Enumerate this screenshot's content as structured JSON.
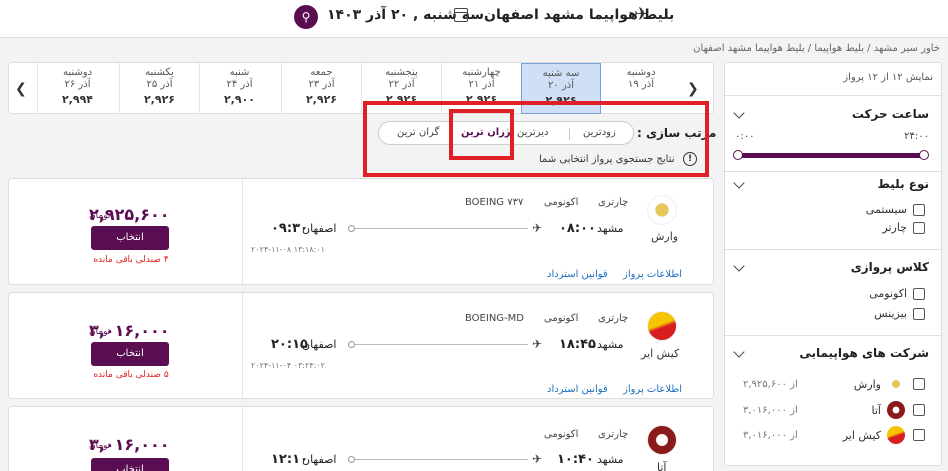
{
  "header": {
    "title": "بلیط هواپیما مشهد اصفهان",
    "date": "سه شنبه , ۲۰ آذر ۱۴۰۳"
  },
  "breadcrumb": "خاور سیر مشهد / بلیط هواپیما / بلیط هواپیما مشهد اصفهان",
  "sidebar": {
    "count": "نمایش ۱۲ از ۱۲ پرواز",
    "departure_time": {
      "title": "ساعت حرکت",
      "min": "۰:۰۰",
      "max": "۲۴:۰۰"
    },
    "ticket_type": {
      "title": "نوع بلیط",
      "options": [
        "سیستمی",
        "چارتر"
      ]
    },
    "flight_class": {
      "title": "کلاس پروازی",
      "options": [
        "اکونومی",
        "بیزینس"
      ]
    },
    "airlines": {
      "title": "شرکت های هواپیمایی",
      "items": [
        {
          "name": "وارش",
          "price": "از ۲,۹۲۵,۶۰۰",
          "color": "#c9a227"
        },
        {
          "name": "آتا",
          "price": "از ۳,۰۱۶,۰۰۰",
          "color": "#8b1a1a"
        },
        {
          "name": "کیش ایر",
          "price": "از ۳,۰۱۶,۰۰۰",
          "color": "#e8b400"
        }
      ]
    }
  },
  "date_strip": {
    "cells": [
      {
        "day": "دوشنبه",
        "date": "۱۹ آذر",
        "price": ""
      },
      {
        "day": "سه شنبه",
        "date": "۲۰ آذر",
        "price": "۲,۹۲۶",
        "selected": true
      },
      {
        "day": "چهارشنبه",
        "date": "۲۱ آذر",
        "price": "۲,۹۲۶"
      },
      {
        "day": "پنجشنبه",
        "date": "۲۲ آذر",
        "price": "۲,۹۲۶"
      },
      {
        "day": "جمعه",
        "date": "۲۳ آذر",
        "price": "۲,۹۲۶"
      },
      {
        "day": "شنبه",
        "date": "۲۴ آذر",
        "price": "۲,۹۰۰"
      },
      {
        "day": "یکشنبه",
        "date": "۲۵ آذر",
        "price": "۲,۹۲۶"
      },
      {
        "day": "دوشنبه",
        "date": "۲۶ آذر",
        "price": "۲,۹۹۴"
      }
    ]
  },
  "sort": {
    "label": "مرتب سازی :",
    "options": [
      "زودترین",
      "دیرترین",
      "ارزان ترین",
      "گران ترین"
    ],
    "active": "ارزان ترین"
  },
  "info": "نتایج جستجوی پرواز انتخابی شما",
  "flights": [
    {
      "airline": "وارش",
      "logo_color": "#c9a227",
      "type": "چارتری",
      "class": "اکونومی",
      "aircraft": "BOEING ۷۳۷",
      "origin": "مشهد",
      "dep": "۰۸:۰۰",
      "dest": "اصفهان",
      "arr": "۰۹:۳۰",
      "stamp": "۲۰۲۴-۱۱-۰۸ ۱۳:۱۸:۰۱",
      "price": "۲,۹۲۵,۶۰۰",
      "unit": "تومان",
      "select": "انتخاب",
      "seats": "۴ صندلی باقی مانده",
      "rules": "قوانین استرداد",
      "info": "اطلاعات پرواز"
    },
    {
      "airline": "کیش ایر",
      "logo_color": "#e8b400",
      "type": "چارتری",
      "class": "اکونومی",
      "aircraft": "BOEING-MD",
      "origin": "مشهد",
      "dep": "۱۸:۴۵",
      "dest": "اصفهان",
      "arr": "۲۰:۱۵",
      "stamp": "۲۰۲۴-۱۱-۰۴ ۰۳:۲۴:۰۲",
      "price": "۳,۰۱۶,۰۰۰",
      "unit": "تومان",
      "select": "انتخاب",
      "seats": "۵ صندلی باقی مانده",
      "rules": "قوانین استرداد",
      "info": "اطلاعات پرواز"
    },
    {
      "airline": "آتا",
      "logo_color": "#8b1a1a",
      "type": "چارتری",
      "class": "اکونومی",
      "aircraft": "",
      "origin": "مشهد",
      "dep": "۱۰:۴۰",
      "dest": "اصفهان",
      "arr": "۱۲:۱۰",
      "stamp": "",
      "price": "۳,۰۱۶,۰۰۰",
      "unit": "تومان",
      "select": "انتخاب",
      "seats": "",
      "rules": "",
      "info": ""
    }
  ]
}
